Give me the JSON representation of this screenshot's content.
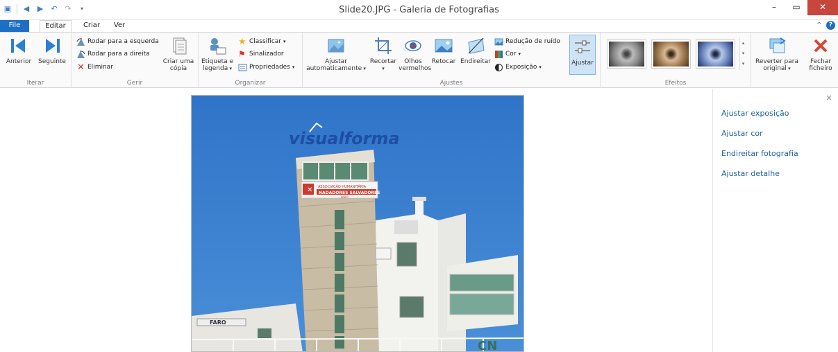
{
  "window": {
    "title": "Slide20.JPG - Galeria de Fotografias",
    "minimize": "–",
    "restore": "▭",
    "close": "✕"
  },
  "tabs": [
    {
      "label": "File"
    },
    {
      "label": "Editar"
    },
    {
      "label": "Criar"
    },
    {
      "label": "Ver"
    }
  ],
  "ribbon": {
    "iterar": {
      "label": "Iterar",
      "anterior": "Anterior",
      "seguinte": "Seguinte"
    },
    "gerir": {
      "label": "Gerir",
      "rodar_esquerda": "Rodar para a esquerda",
      "rodar_direita": "Rodar para a direita",
      "eliminar": "Eliminar",
      "criar_copia_1": "Criar uma",
      "criar_copia_2": "cópia"
    },
    "organizar": {
      "label": "Organizar",
      "etiqueta_1": "Etiqueta e",
      "etiqueta_2": "legenda",
      "classificar": "Classificar",
      "sinalizador": "Sinalizador",
      "propriedades": "Propriedades"
    },
    "ajustes": {
      "label": "Ajustes",
      "ajustar_auto_1": "Ajustar",
      "ajustar_auto_2": "automaticamente",
      "recortar": "Recortar",
      "olhos_1": "Olhos",
      "olhos_2": "vermelhos",
      "retocar": "Retocar",
      "endireitar": "Endireitar",
      "reducao_ruido": "Redução de ruído",
      "cor": "Cor",
      "exposicao": "Exposição",
      "ajustar": "Ajustar"
    },
    "efeitos": {
      "label": "Efeitos"
    },
    "reverter_1": "Reverter para",
    "reverter_2": "original",
    "fechar_1": "Fechar",
    "fechar_2": "ficheiro"
  },
  "photo": {
    "sign": "visualforma",
    "banner_1": "ASSOCIAÇÃO HUMANITÁRIA",
    "banner_2": "NADADORES SALVADORES",
    "banner_3": "FARO",
    "faro_sign": "FARO",
    "letters": "CN"
  },
  "panel": {
    "close": "×",
    "items": [
      {
        "label": "Ajustar exposição"
      },
      {
        "label": "Ajustar cor"
      },
      {
        "label": "Endireitar fotografia"
      },
      {
        "label": "Ajustar detalhe"
      }
    ]
  },
  "colors": {
    "accent": "#1d6fc5",
    "close_button": "#c7473c",
    "panel_link": "#1e5f9e",
    "sky": "#2f74c8"
  }
}
